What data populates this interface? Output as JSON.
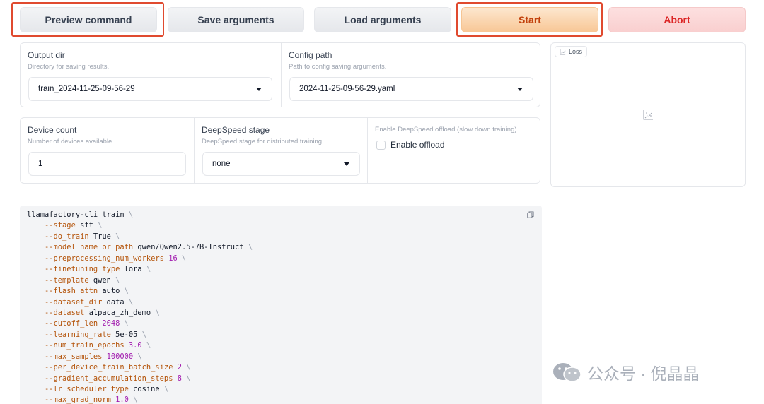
{
  "actions": {
    "preview_label": "Preview command",
    "save_label": "Save arguments",
    "load_label": "Load arguments",
    "start_label": "Start",
    "abort_label": "Abort"
  },
  "output": {
    "output_dir_label": "Output dir",
    "output_dir_info": "Directory for saving results.",
    "output_dir_value": "train_2024-11-25-09-56-29",
    "config_path_label": "Config path",
    "config_path_info": "Path to config saving arguments.",
    "config_path_value": "2024-11-25-09-56-29.yaml"
  },
  "device": {
    "count_label": "Device count",
    "count_info": "Number of devices available.",
    "count_value": "1",
    "ds_stage_label": "DeepSpeed stage",
    "ds_stage_info": "DeepSpeed stage for distributed training.",
    "ds_stage_value": "none",
    "offload_info": "Enable DeepSpeed offload (slow down training).",
    "offload_label": "Enable offload",
    "offload_checked": false
  },
  "plot": {
    "tag_label": "Loss"
  },
  "command": {
    "lines": [
      {
        "flag": "",
        "cmd": "llamafactory-cli train",
        "value": "",
        "numeric": false
      },
      {
        "flag": "--stage",
        "value": "sft",
        "numeric": false
      },
      {
        "flag": "--do_train",
        "value": "True",
        "numeric": false
      },
      {
        "flag": "--model_name_or_path",
        "value": "qwen/Qwen2.5-7B-Instruct",
        "numeric": false
      },
      {
        "flag": "--preprocessing_num_workers",
        "value": "16",
        "numeric": true
      },
      {
        "flag": "--finetuning_type",
        "value": "lora",
        "numeric": false
      },
      {
        "flag": "--template",
        "value": "qwen",
        "numeric": false
      },
      {
        "flag": "--flash_attn",
        "value": "auto",
        "numeric": false
      },
      {
        "flag": "--dataset_dir",
        "value": "data",
        "numeric": false
      },
      {
        "flag": "--dataset",
        "value": "alpaca_zh_demo",
        "numeric": false
      },
      {
        "flag": "--cutoff_len",
        "value": "2048",
        "numeric": true
      },
      {
        "flag": "--learning_rate",
        "value": "5e-05",
        "numeric": false
      },
      {
        "flag": "--num_train_epochs",
        "value": "3.0",
        "numeric": true
      },
      {
        "flag": "--max_samples",
        "value": "100000",
        "numeric": true
      },
      {
        "flag": "--per_device_train_batch_size",
        "value": "2",
        "numeric": true
      },
      {
        "flag": "--gradient_accumulation_steps",
        "value": "8",
        "numeric": true
      },
      {
        "flag": "--lr_scheduler_type",
        "value": "cosine",
        "numeric": false
      },
      {
        "flag": "--max_grad_norm",
        "value": "1.0",
        "numeric": true
      }
    ]
  },
  "watermark": {
    "text": "公众号 · 倪晶晶"
  },
  "colors": {
    "accent": "#f8c796",
    "highlight": "#e04a2f",
    "stop": "#dc2626"
  }
}
